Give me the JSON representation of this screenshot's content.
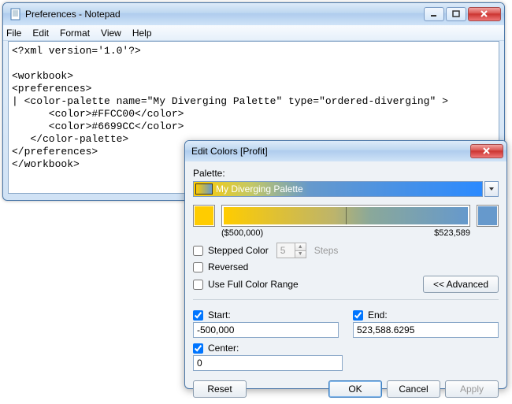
{
  "notepad": {
    "title": "Preferences - Notepad",
    "menu": [
      "File",
      "Edit",
      "Format",
      "View",
      "Help"
    ],
    "content_lines": [
      "<?xml version='1.0'?>",
      "",
      "<workbook>",
      "<preferences>",
      "| <color-palette name=\"My Diverging Palette\" type=\"ordered-diverging\" >",
      "      <color>#FFCC00</color>",
      "      <color>#6699CC</color>",
      "   </color-palette>",
      "</preferences>",
      "</workbook>"
    ]
  },
  "dialog": {
    "title": "Edit Colors [Profit]",
    "palette_label": "Palette:",
    "palette_name": "My Diverging Palette",
    "range_min": "($500,000)",
    "range_max": "$523,589",
    "stepped_label": "Stepped Color",
    "stepped_value": "5",
    "steps_label": "Steps",
    "reversed_label": "Reversed",
    "full_range_label": "Use Full Color Range",
    "advanced_label": "<< Advanced",
    "start_label": "Start:",
    "start_value": "-500,000",
    "end_label": "End:",
    "end_value": "523,588.6295",
    "center_label": "Center:",
    "center_value": "0",
    "reset": "Reset",
    "ok": "OK",
    "cancel": "Cancel",
    "apply": "Apply",
    "colors": {
      "start": "#FFCC00",
      "end": "#6699CC"
    }
  }
}
